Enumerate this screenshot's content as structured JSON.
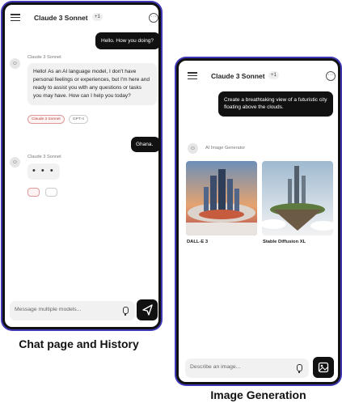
{
  "chat": {
    "title": "Claude 3 Sonnet",
    "badge": "+1",
    "messages": {
      "user1": "Hello. How you doing?",
      "bot1_sender": "Claude 3 Sonnet",
      "bot1_text": "Hello! As an AI language model, I don't have personal feelings or experiences, but I'm here and ready to assist you with any questions or tasks you may have. How can I help you today?",
      "chip_claude": "Claude 3 Sonnet",
      "chip_gpt": "GPT-4",
      "user2": "Ghana.",
      "bot2_sender": "Claude 3 Sonnet",
      "bot2_typing": "• • •"
    },
    "input_placeholder": "Message multiple models...",
    "caption": "Chat page and History"
  },
  "imagegen": {
    "title": "Claude 3 Sonnet",
    "badge": "+1",
    "prompt": "Create a breathtaking view of a futuristic city floating above the clouds.",
    "generator_label": "AI Image Generator",
    "images": [
      {
        "label": "DALL-E 3"
      },
      {
        "label": "Stable Diffusion XL"
      }
    ],
    "input_placeholder": "Describe an image...",
    "caption": "Image Generation"
  },
  "colors": {
    "frame_accent": "#3f37b5",
    "bubble_dark": "#111111",
    "bubble_light": "#f1f1f1"
  },
  "icons": [
    "menu-icon",
    "more-icon",
    "bot-avatar-icon",
    "mic-icon",
    "send-icon",
    "image-generate-icon",
    "copy-icon"
  ]
}
